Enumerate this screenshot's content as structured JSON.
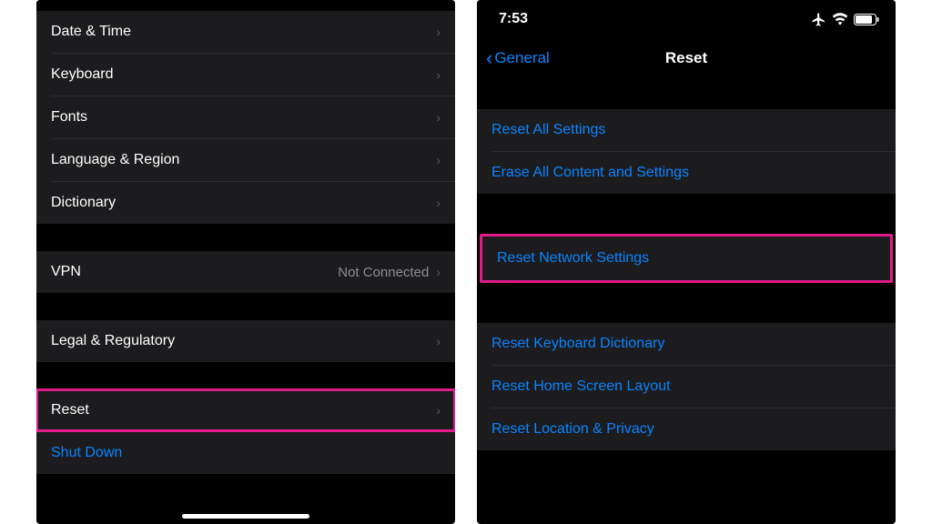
{
  "left": {
    "items_group1": [
      {
        "label": "Date & Time"
      },
      {
        "label": "Keyboard"
      },
      {
        "label": "Fonts"
      },
      {
        "label": "Language & Region"
      },
      {
        "label": "Dictionary"
      }
    ],
    "vpn": {
      "label": "VPN",
      "value": "Not Connected"
    },
    "legal": {
      "label": "Legal & Regulatory"
    },
    "reset": {
      "label": "Reset"
    },
    "shutdown": {
      "label": "Shut Down"
    }
  },
  "right": {
    "status": {
      "time": "7:53"
    },
    "nav": {
      "back": "General",
      "title": "Reset"
    },
    "group1": [
      {
        "label": "Reset All Settings"
      },
      {
        "label": "Erase All Content and Settings"
      }
    ],
    "network": {
      "label": "Reset Network Settings"
    },
    "group3": [
      {
        "label": "Reset Keyboard Dictionary"
      },
      {
        "label": "Reset Home Screen Layout"
      },
      {
        "label": "Reset Location & Privacy"
      }
    ]
  },
  "colors": {
    "link": "#0a84ff",
    "highlight": "#e11a8b"
  }
}
